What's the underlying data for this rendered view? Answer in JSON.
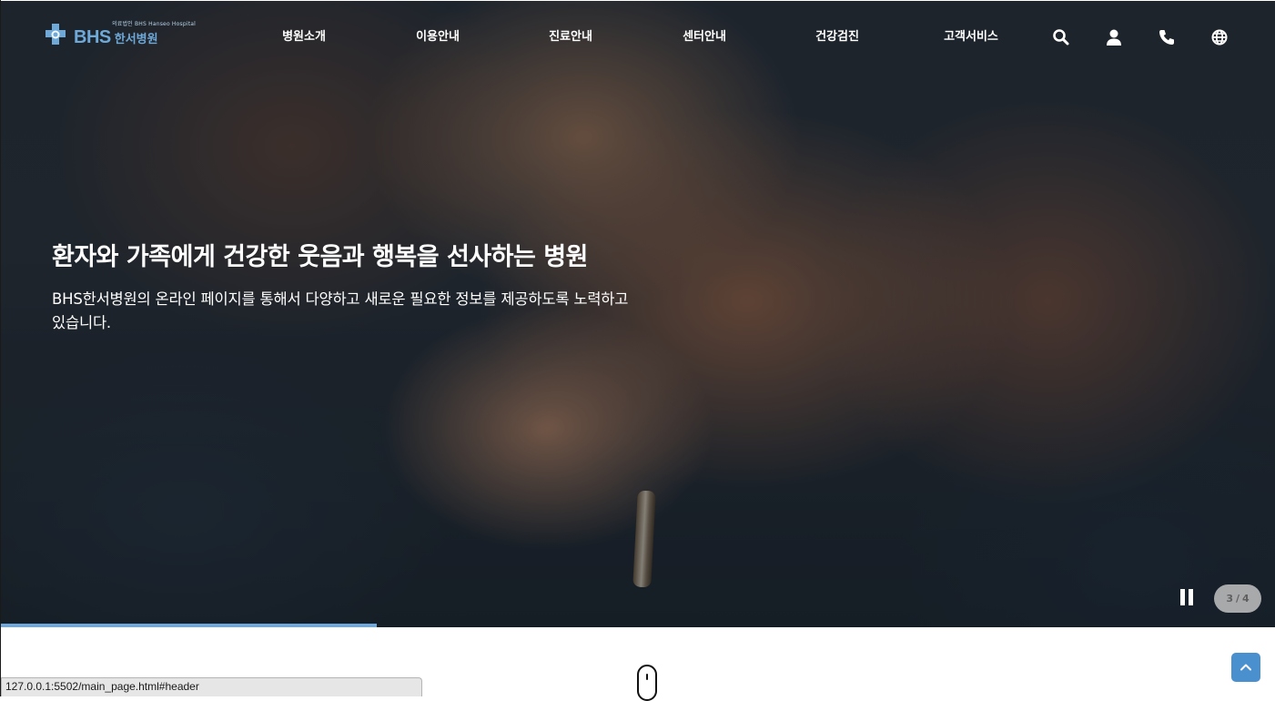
{
  "header": {
    "logo": {
      "tagline": "의료법인 BHS Hanseo Hospital",
      "brand": "BHS",
      "name": "한서병원"
    },
    "nav": [
      {
        "label": "병원소개"
      },
      {
        "label": "이용안내"
      },
      {
        "label": "진료안내"
      },
      {
        "label": "센터안내"
      },
      {
        "label": "건강검진"
      },
      {
        "label": "고객서비스"
      }
    ],
    "utility_icons": [
      "search-icon",
      "user-icon",
      "phone-icon",
      "globe-icon"
    ]
  },
  "hero": {
    "title": "환자와 가족에게 건강한 웃음과 행복을 선사하는 병원",
    "description": "BHS한서병원의 온라인 페이지를 통해서 다양하고 새로운 필요한 정보를 제공하도록 노력하고 있습니다.",
    "slider": {
      "current": "3",
      "separator": "/",
      "total": "4",
      "progress": 0.295
    }
  },
  "status_bar": {
    "url": "127.0.0.1:5502/main_page.html#header"
  },
  "colors": {
    "accent": "#4a90cf",
    "progress": "#6ea8dd",
    "logo": "#6ea9d8"
  }
}
